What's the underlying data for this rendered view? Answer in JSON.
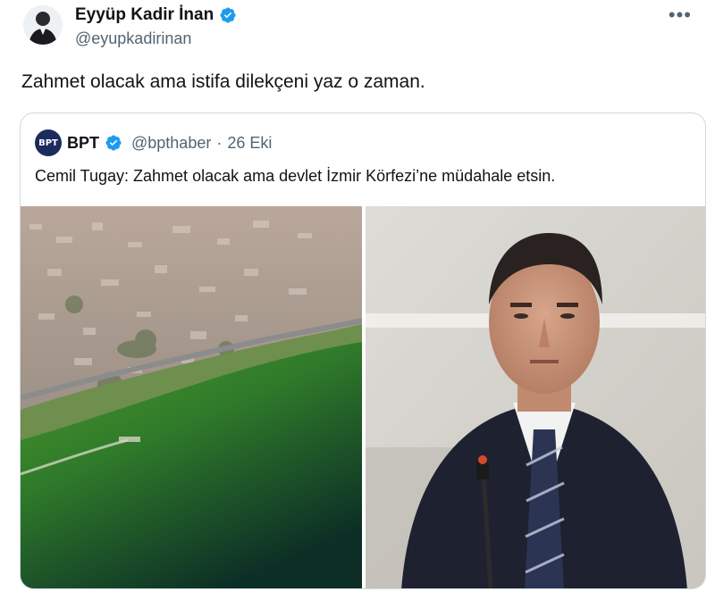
{
  "author": {
    "display_name": "Eyyüp Kadir İnan",
    "handle": "@eyupkadirinan",
    "verified": true,
    "avatar_icon": "person-avatar"
  },
  "menu_icon": "more-options-icon",
  "tweet_text": "Zahmet olacak ama istifa dilekçeni yaz o zaman.",
  "quote": {
    "source_name": "BPT",
    "logo_text": "BPT",
    "handle": "@bpthaber",
    "separator": "·",
    "date": "26 Eki",
    "text": "Cemil Tugay: Zahmet olacak ama devlet İzmir Körfezi’ne müdahale etsin.",
    "media": [
      {
        "name": "aerial-gulf-photo"
      },
      {
        "name": "speaker-portrait-photo"
      }
    ]
  },
  "colors": {
    "verified_blue": "#1d9bf0",
    "secondary_text": "#536471",
    "border": "#cfd9de"
  }
}
